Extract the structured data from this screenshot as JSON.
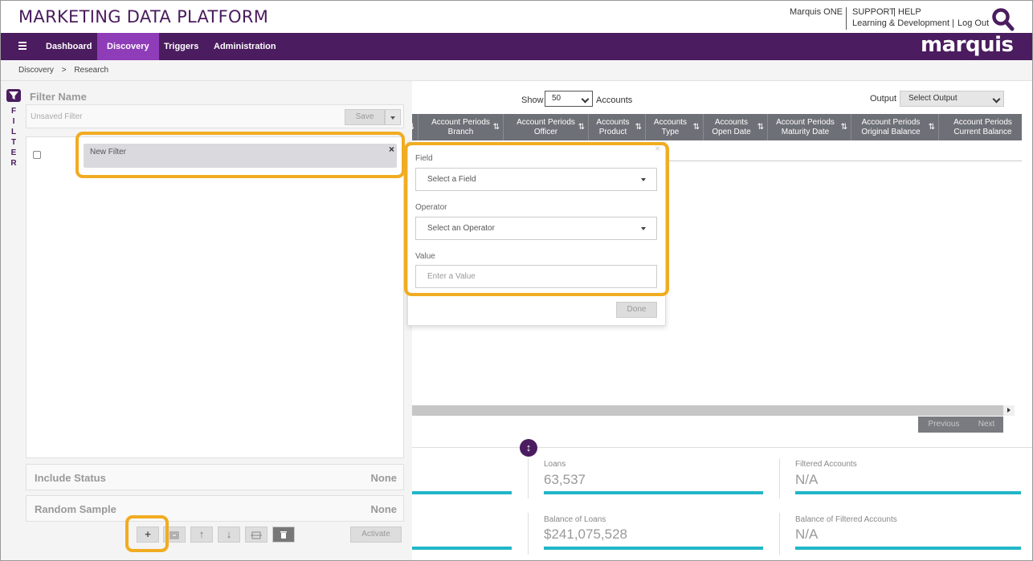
{
  "header": {
    "app_title": "MARKETING DATA PLATFORM",
    "links": {
      "marquis_one": "Marquis ONE",
      "support": "SUPPORT",
      "divider": "|",
      "help": "HELP",
      "learning": "Learning & Development",
      "log_out": "Log Out"
    },
    "search_icon": "magnifier-icon"
  },
  "nav": {
    "items": [
      {
        "label": "Dashboard"
      },
      {
        "label": "Discovery",
        "active": true
      },
      {
        "label": "Triggers"
      },
      {
        "label": "Administration"
      }
    ],
    "brand": "marquis"
  },
  "breadcrumb": {
    "items": [
      "Discovery",
      "Research"
    ],
    "separator": ">"
  },
  "filter_tab": {
    "letters": [
      "F",
      "I",
      "L",
      "T",
      "E",
      "R"
    ]
  },
  "filter_panel": {
    "name_label": "Filter Name",
    "name_placeholder": "Unsaved Filter",
    "save_label": "Save",
    "new_filter_label": "New Filter",
    "close_symbol": "×",
    "include_status": {
      "label": "Include Status",
      "value": "None"
    },
    "random_sample": {
      "label": "Random Sample",
      "value": "None"
    },
    "toolbar": {
      "add": "+",
      "up": "↑",
      "down": "↓",
      "trash": "🗑",
      "activate_label": "Activate"
    }
  },
  "grid": {
    "show_label": "Show",
    "show_value": "50",
    "accounts_label": "Accounts",
    "output_label": "Output",
    "output_value": "Select Output",
    "sort_icon": "⇅",
    "columns": [
      {
        "line1": "Account Periods",
        "line2": "Branch"
      },
      {
        "line1": "Account Periods",
        "line2": "Officer"
      },
      {
        "line1": "Accounts",
        "line2": "Product"
      },
      {
        "line1": "Accounts",
        "line2": "Type"
      },
      {
        "line1": "Accounts",
        "line2": "Open Date"
      },
      {
        "line1": "Account Periods",
        "line2": "Maturity Date"
      },
      {
        "line1": "Account Periods",
        "line2": "Original Balance"
      },
      {
        "line1": "Account Periods",
        "line2": "Current Balance"
      }
    ],
    "pager": {
      "previous": "Previous",
      "next": "Next"
    }
  },
  "stats": [
    {
      "label": "Loans",
      "value": "63,537"
    },
    {
      "label": "Filtered Accounts",
      "value": "N/A"
    },
    {
      "label": "Balance of Loans",
      "value": "$241,075,528"
    },
    {
      "label": "Balance of Filtered Accounts",
      "value": "N/A"
    }
  ],
  "popup": {
    "field_label": "Field",
    "field_placeholder": "Select a Field",
    "operator_label": "Operator",
    "operator_placeholder": "Select an Operator",
    "value_label": "Value",
    "value_placeholder": "Enter a Value",
    "done_label": "Done",
    "close_symbol": "×"
  },
  "colors": {
    "brand_purple": "#4b1c5f",
    "active_tab": "#8e3cb8",
    "highlight": "#f1ac21",
    "stat_bar": "#21b6c7"
  }
}
